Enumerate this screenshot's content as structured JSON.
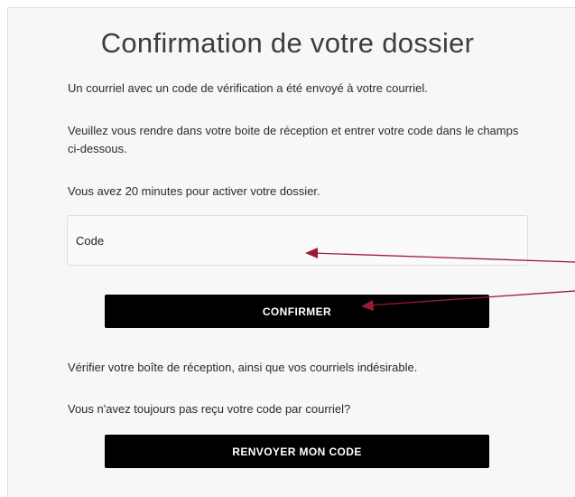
{
  "page": {
    "title": "Confirmation de votre dossier",
    "paragraph_email_sent": "Un courriel avec un code de vérification a été envoyé à votre courriel.",
    "paragraph_instructions": "Veuillez vous rendre dans votre boite de réception et entrer votre code dans le champs ci-dessous.",
    "paragraph_time_limit": "Vous avez 20 minutes pour activer votre dossier.",
    "paragraph_check_inbox": "Vérifier votre boîte de réception, ainsi que vos courriels indésirable.",
    "paragraph_not_received": "Vous n'avez toujours pas reçu votre code par courriel?"
  },
  "form": {
    "code_placeholder": "Code",
    "code_value": "",
    "confirm_label": "CONFIRMER",
    "resend_label": "RENVOYER MON CODE"
  },
  "annotations": {
    "arrow_color": "#9b1b30"
  }
}
